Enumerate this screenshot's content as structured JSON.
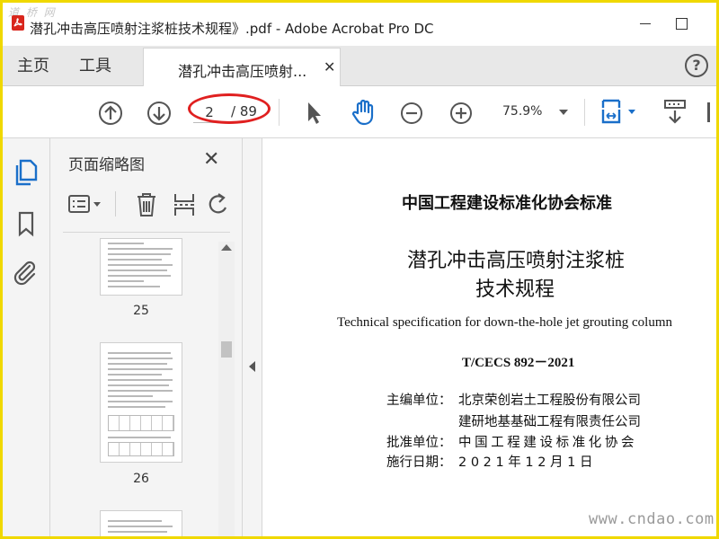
{
  "window": {
    "title": "潜孔冲击高压喷射注浆桩技术规程》.pdf - Adobe Acrobat Pro DC",
    "watermark_top": "道 桥 网"
  },
  "tabs": {
    "home": "主页",
    "tools": "工具",
    "document": "潜孔冲击高压喷射...",
    "close_glyph": "✕",
    "help_glyph": "?"
  },
  "toolbar": {
    "current_page": "2",
    "total_pages": "/ 89",
    "zoom": "75.9%"
  },
  "panel": {
    "title": "页面缩略图",
    "close_glyph": "✕",
    "thumbnails": [
      {
        "label": "25"
      },
      {
        "label": "26"
      }
    ]
  },
  "document": {
    "org_heading": "中国工程建设标准化协会标准",
    "title_line1": "潜孔冲击高压喷射注浆桩",
    "title_line2": "技术规程",
    "title_en": "Technical specification for down-the-hole jet grouting column",
    "code": "T/CECS 892－2021",
    "editor_label": "主编单位：",
    "editor_1": "北京荣创岩土工程股份有限公司",
    "editor_2": "建研地基基础工程有限责任公司",
    "approver_label": "批准单位：",
    "approver": "中国工程建设标准化协会",
    "date_label": "施行日期：",
    "date": "2021年12月1日"
  },
  "watermark_bottom": "www.cndao.com",
  "colors": {
    "accent_blue": "#1a6fc9",
    "highlight_red": "#e02020",
    "frame_yellow": "#f0d800"
  }
}
